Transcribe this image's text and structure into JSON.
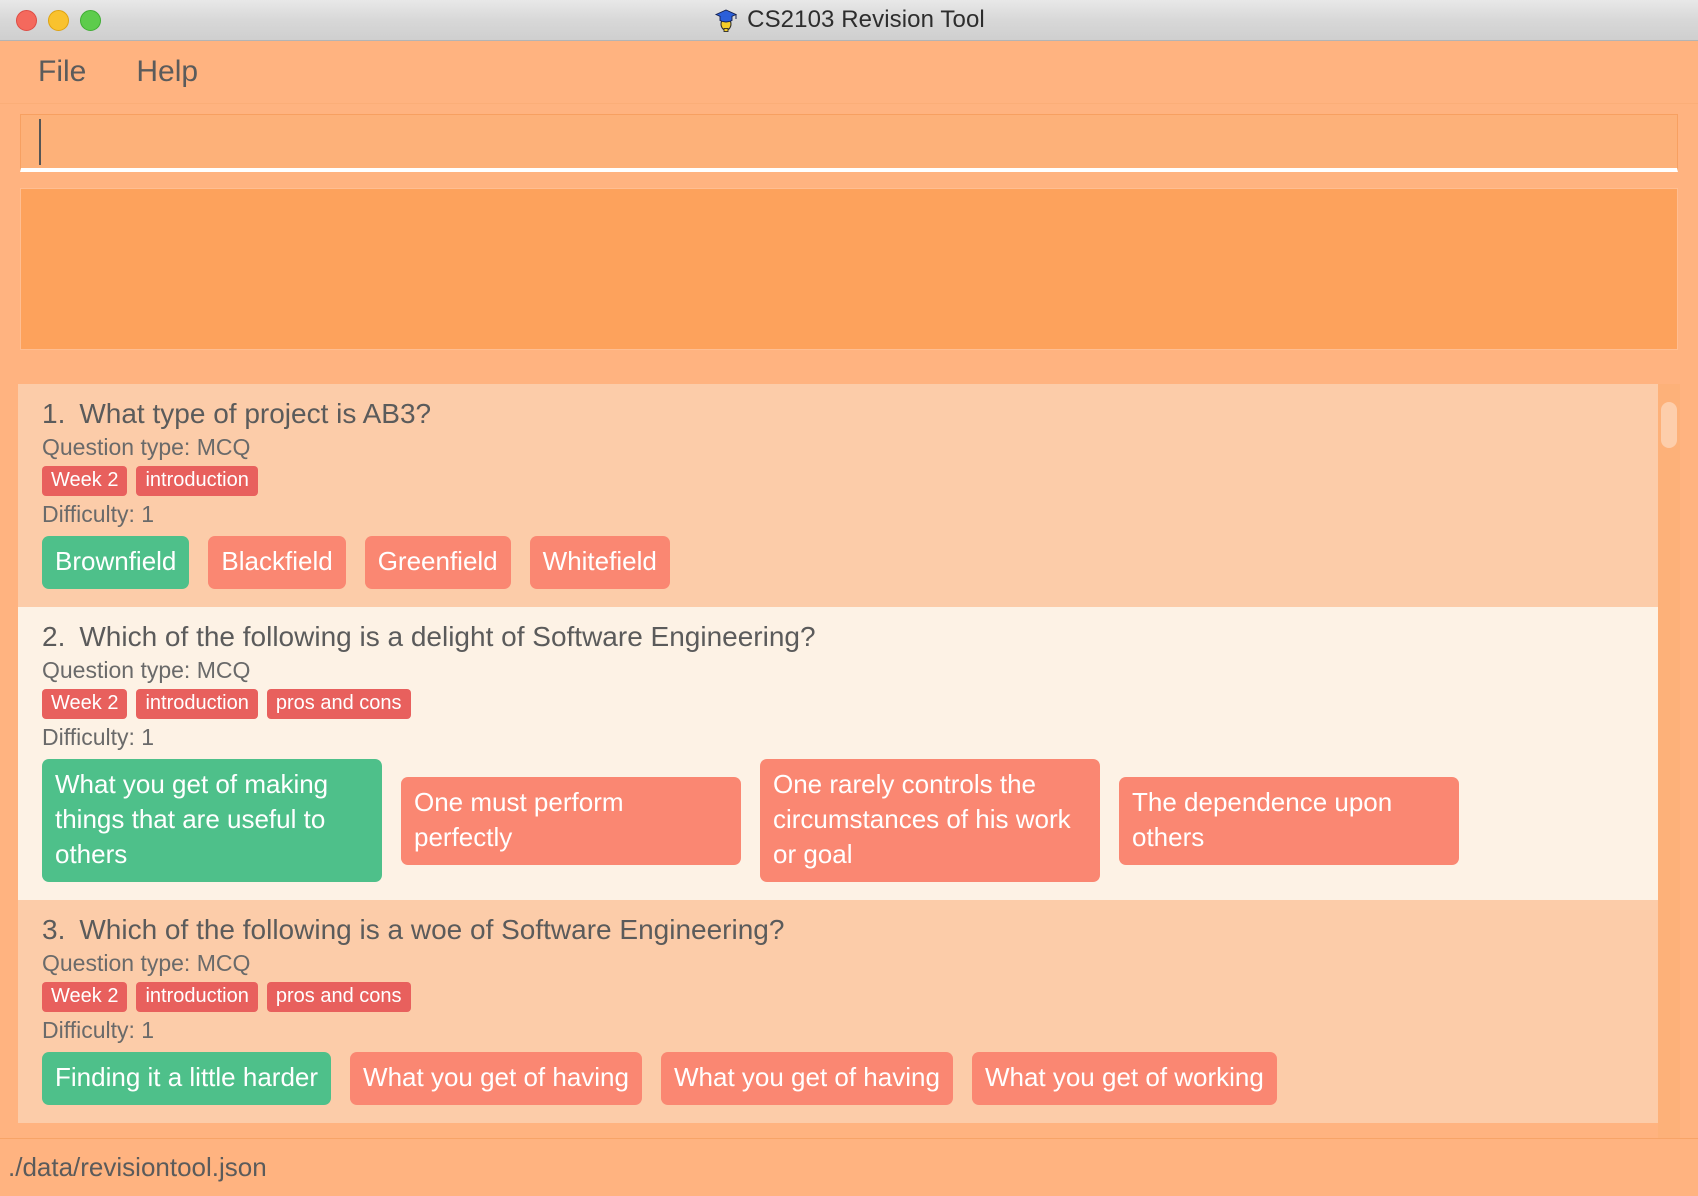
{
  "window": {
    "title": "CS2103 Revision Tool",
    "app_icon": "graduation-cap-lightbulb-icon",
    "controls": {
      "close": "close-button",
      "minimize": "minimize-button",
      "maximize": "maximize-button"
    },
    "colors": {
      "chrome": "#d8d8d8",
      "body_background": "#FFB380",
      "panel_background": "#FDA25C",
      "row_odd": "#FCCCA9",
      "row_even": "#FDF2E5",
      "tag": "#E8605D",
      "option_correct": "#4EC08A",
      "option_wrong": "#FA8772",
      "text": "#5b5b5b"
    }
  },
  "menubar": {
    "items": [
      {
        "label": "File"
      },
      {
        "label": "Help"
      }
    ]
  },
  "search": {
    "value": "",
    "placeholder": ""
  },
  "result_panel": {
    "content": ""
  },
  "questions": [
    {
      "number": "1.",
      "text": "What type of project is AB3?",
      "question_type_label": "Question type: MCQ",
      "tags": [
        "Week 2",
        "introduction"
      ],
      "difficulty_label": "Difficulty: 1",
      "options": [
        {
          "label": "Brownfield",
          "state": "correct"
        },
        {
          "label": "Blackfield",
          "state": "wrong"
        },
        {
          "label": "Greenfield",
          "state": "wrong"
        },
        {
          "label": "Whitefield",
          "state": "wrong"
        }
      ]
    },
    {
      "number": "2.",
      "text": "Which of the following is a delight of Software Engineering?",
      "question_type_label": "Question type: MCQ",
      "tags": [
        "Week 2",
        "introduction",
        "pros and cons"
      ],
      "difficulty_label": "Difficulty: 1",
      "options": [
        {
          "label": "What you get of making things that are useful to others",
          "state": "correct"
        },
        {
          "label": "One must perform perfectly",
          "state": "wrong"
        },
        {
          "label": "One rarely controls the circumstances of his work or goal",
          "state": "wrong"
        },
        {
          "label": "The dependence upon others",
          "state": "wrong"
        }
      ]
    },
    {
      "number": "3.",
      "text": "Which of the following is a woe of Software Engineering?",
      "question_type_label": "Question type: MCQ",
      "tags": [
        "Week 2",
        "introduction",
        "pros and cons"
      ],
      "difficulty_label": "Difficulty: 1",
      "options": [
        {
          "label": "Finding it a little harder",
          "state": "correct"
        },
        {
          "label": "What you get of having",
          "state": "wrong"
        },
        {
          "label": "What you get of having",
          "state": "wrong"
        },
        {
          "label": "What you get of working",
          "state": "wrong"
        }
      ]
    }
  ],
  "statusbar": {
    "path": "./data/revisiontool.json"
  }
}
